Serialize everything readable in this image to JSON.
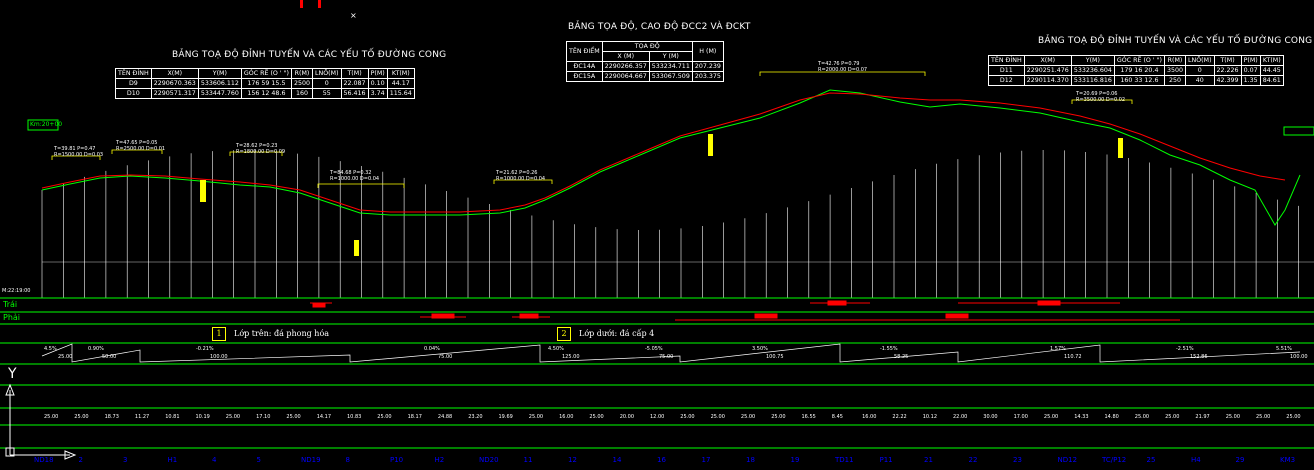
{
  "titles": {
    "left": "BẢNG TOẠ ĐỘ ĐỈNH TUYẾN VÀ CÁC YẾU TỐ ĐƯỜNG CONG",
    "center": "BẢNG TỌA ĐỘ, CAO ĐỘ ĐCC2 VÀ ĐCKT",
    "right": "BẢNG TOẠ ĐỘ ĐỈNH TUYẾN VÀ CÁC YẾU TỐ ĐƯỜNG CONG"
  },
  "table_left": {
    "headers": [
      "TÊN ĐỈNH",
      "X(M)",
      "Y(M)",
      "GÓC RẼ (O ' \")",
      "R(M)",
      "LNỐ(M)",
      "T(M)",
      "P(M)",
      "KT(M)"
    ],
    "rows": [
      [
        "D9",
        "2290670.363",
        "533606.112",
        "176 59 15.5",
        "2500",
        "0",
        "22.087",
        "0.10",
        "44.17"
      ],
      [
        "D10",
        "2290571.317",
        "533447.760",
        "156 12 48.6",
        "160",
        "55",
        "56.416",
        "3.74",
        "115.64"
      ]
    ]
  },
  "table_center": {
    "headers": [
      "TÊN ĐIỂM",
      "TỌA ĐỘ",
      "H (M)"
    ],
    "subheaders": [
      "X (M)",
      "Y (M)"
    ],
    "rows": [
      [
        "ĐC14A",
        "2290266.357",
        "533234.711",
        "207.239"
      ],
      [
        "ĐC15A",
        "2290064.667",
        "533067.509",
        "203.375"
      ]
    ]
  },
  "table_right": {
    "headers": [
      "TÊN ĐỈNH",
      "X(M)",
      "Y(M)",
      "GÓC RẼ (O ' \")",
      "R(M)",
      "LNỐ(M)",
      "T(M)",
      "P(M)",
      "KT(M)"
    ],
    "rows": [
      [
        "D11",
        "2290251.476",
        "533236.604",
        "179 16 20.4",
        "3500",
        "0",
        "22.226",
        "0.07",
        "44.45"
      ],
      [
        "D12",
        "2290114.370",
        "533116.816",
        "160 33 12.6",
        "250",
        "40",
        "42.399",
        "1.35",
        "84.61"
      ]
    ]
  },
  "side_labels": {
    "left_bank": "Trái",
    "right_bank": "Phải",
    "km": "Km:20+00",
    "scale": "M:22:19:00"
  },
  "layers": [
    {
      "num": "1",
      "text": "Lớp trên: đá phong hóa"
    },
    {
      "num": "2",
      "text": "Lớp dưới: đá cấp 4"
    }
  ],
  "curve_labels": [
    "T=39.81 P=0.47 R=1500.00 D=0.03",
    "T=47.65 P=0.05 R=2500.00 D=0.01",
    "T=28.62 P=0.23 R=1800.00 D=0.09",
    "T=84.68 P=0.32 R=1000.00 D=0.04",
    "T=21.62 P=0.26 R=1000.00 D=0.04",
    "T=42.76 P=0.79 R=2000.00 D=0.07",
    "T=20.69 P=0.06 R=3500.00 D=0.02"
  ],
  "grades": [
    "4.5%",
    "0.90%",
    "-0.21%",
    "0.04%",
    "4.50%",
    "-5.05%",
    "3.50%",
    "-1.55%",
    "1.57%",
    "-2.51%",
    "5.51%"
  ],
  "grade_lengths": [
    "25.00",
    "50.00",
    "100.00",
    "75.00",
    "125.00",
    "75.00",
    "100.75",
    "58.25",
    "110.72",
    "152.86",
    "100.00"
  ],
  "stations": [
    "ND18",
    "2",
    "3",
    "H1",
    "4",
    "5",
    "ND19",
    "8",
    "P10",
    "H2",
    "ND20",
    "11",
    "12",
    "14",
    "16",
    "17",
    "18",
    "19",
    "TD11",
    "P11",
    "21",
    "22",
    "23",
    "ND12",
    "TC/P12",
    "25",
    "H4",
    "29",
    "KM3"
  ],
  "distances": [
    "25.00",
    "25.00",
    "18.73",
    "11.27",
    "10.81",
    "10.19",
    "25.00",
    "17.10",
    "25.00",
    "14.17",
    "10.83",
    "25.00",
    "18.17",
    "24.88",
    "23.20",
    "19.69",
    "25.00",
    "16.00",
    "25.00",
    "20.00",
    "12.00",
    "25.00",
    "25.00",
    "25.00",
    "25.00",
    "16.55",
    "8.45",
    "16.00",
    "22.22",
    "10.12",
    "22.00",
    "30.00",
    "17.00",
    "25.00",
    "14.33",
    "14.80",
    "25.00",
    "25.00",
    "21.97",
    "25.00",
    "25.00",
    "25.00"
  ]
}
